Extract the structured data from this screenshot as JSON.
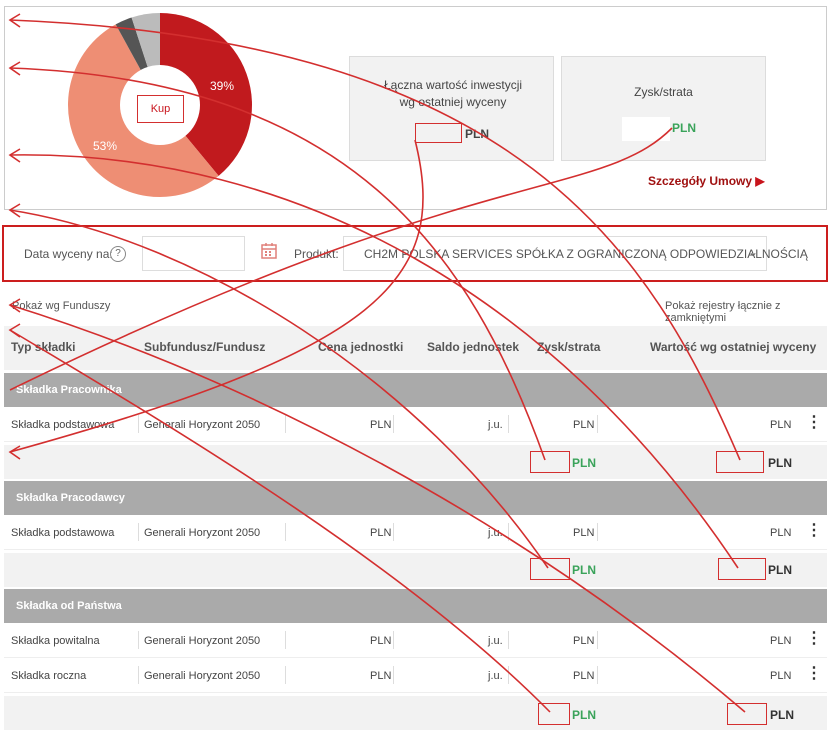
{
  "summary": {
    "button_label": "Kup",
    "chart_labels": [
      "39%",
      "53%"
    ],
    "total_value_label": "Łączna wartość inwestycji wg ostatniej wyceny",
    "total_value_currency": "PLN",
    "profit_loss_label": "Zysk/strata",
    "profit_loss_currency": "PLN",
    "details_link": "Szczegóły Umowy"
  },
  "chart_data": {
    "type": "pie",
    "slices": [
      {
        "value": 39,
        "color": "#c11a1e"
      },
      {
        "value": 53,
        "color": "#ee8e74"
      },
      {
        "value": 3,
        "color": "#555555"
      },
      {
        "value": 5,
        "color": "#bbbbbb"
      }
    ],
    "labels": [
      "39%",
      "53%"
    ]
  },
  "filters": {
    "date_label": "Data wyceny na:",
    "help_icon": "?",
    "product_label": "Produkt:",
    "product_value": "CH2M POLSKA SERVICES SPÓŁKA Z OGRANICZONĄ ODPOWIEDZIALNOŚCIĄ"
  },
  "view_links": {
    "by_fund": "Pokaż wg Funduszy",
    "closed_registers": "Pokaż rejestry łącznie z zamkniętymi"
  },
  "table": {
    "headers": [
      "Typ składki",
      "Subfundusz/Fundusz",
      "Cena jednostki",
      "Saldo jednostek",
      "Zysk/strata",
      "Wartość wg ostatniej wyceny"
    ],
    "groups": [
      {
        "title": "Składka Pracownika",
        "rows": [
          {
            "type": "Składka podstawowa",
            "fund": "Generali Horyzont 2050",
            "price": "PLN",
            "units": "j.u.",
            "profit": "PLN",
            "value": "PLN"
          }
        ],
        "sum": {
          "profit": "PLN",
          "value": "PLN"
        }
      },
      {
        "title": "Składka Pracodawcy",
        "rows": [
          {
            "type": "Składka podstawowa",
            "fund": "Generali Horyzont 2050",
            "price": "PLN",
            "units": "j.u.",
            "profit": "PLN",
            "value": "PLN"
          }
        ],
        "sum": {
          "profit": "PLN",
          "value": "PLN"
        }
      },
      {
        "title": "Składka od Państwa",
        "rows": [
          {
            "type": "Składka powitalna",
            "fund": "Generali Horyzont 2050",
            "price": "PLN",
            "units": "j.u.",
            "profit": "PLN",
            "value": "PLN"
          },
          {
            "type": "Składka roczna",
            "fund": "Generali Horyzont 2050",
            "price": "PLN",
            "units": "j.u.",
            "profit": "PLN",
            "value": "PLN"
          }
        ],
        "sum": {
          "profit": "PLN",
          "value": "PLN"
        }
      }
    ]
  },
  "colors": {
    "accent": "#c8141c",
    "positive": "#3aa35a",
    "annotation": "#d32f2f"
  }
}
